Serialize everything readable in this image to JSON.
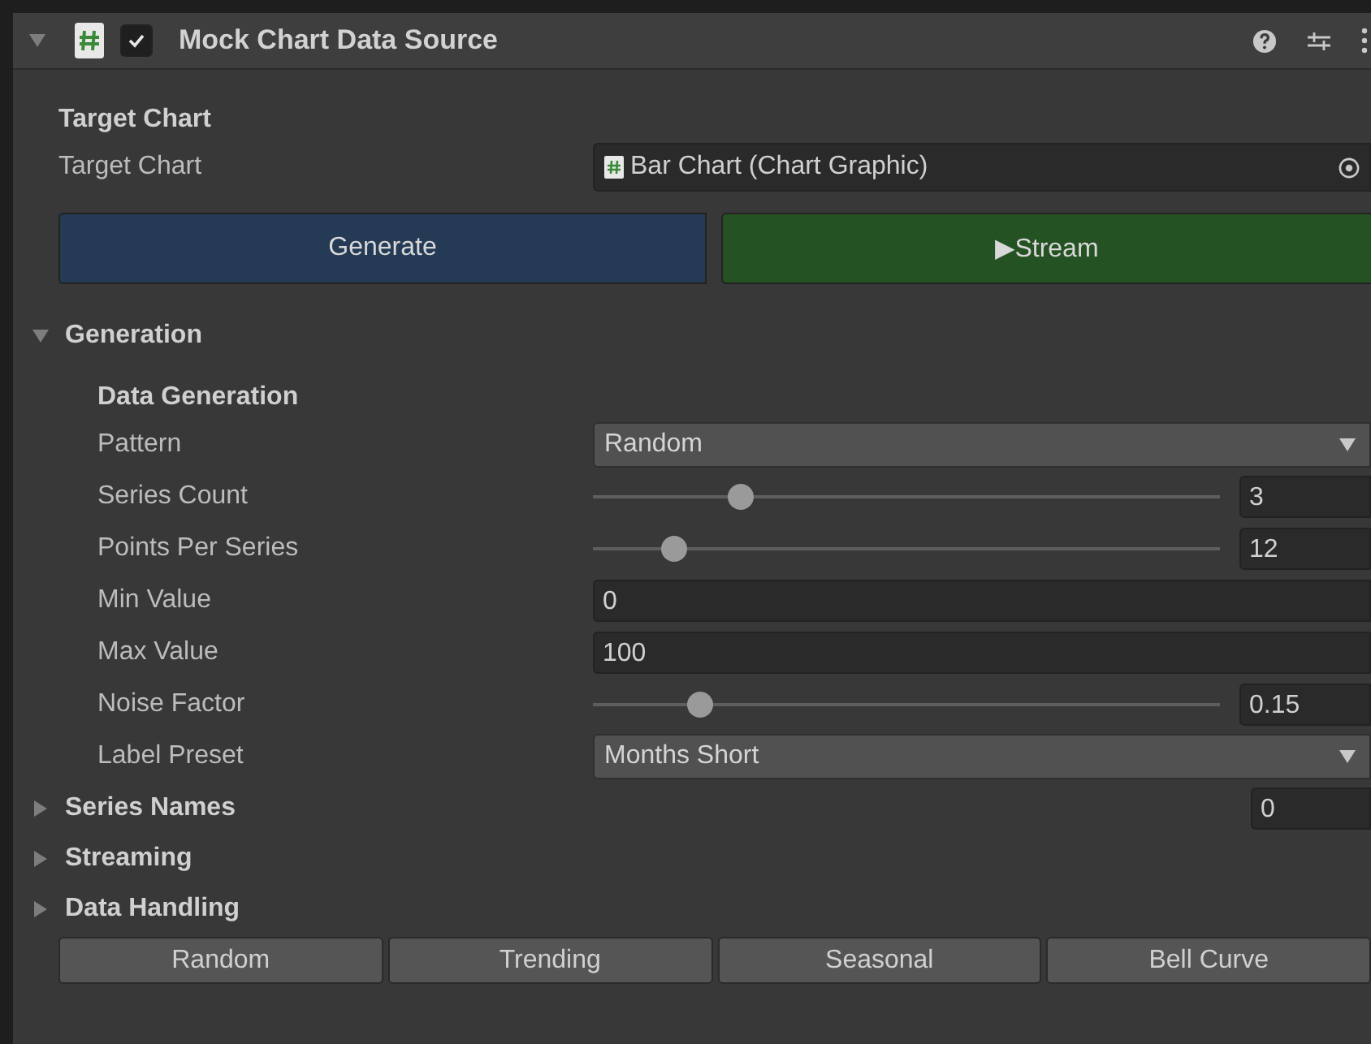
{
  "component": {
    "title": "Mock Chart Data Source",
    "enabled": true,
    "expanded": true
  },
  "target": {
    "heading": "Target Chart",
    "label": "Target Chart",
    "value": "Bar Chart (Chart Graphic)"
  },
  "actions": [
    {
      "label": "Generate",
      "kind": "generate"
    },
    {
      "label": "Stream",
      "icon": "▶",
      "kind": "stream"
    }
  ],
  "generation": {
    "title": "Generation",
    "expanded": true,
    "heading": "Data Generation",
    "fields": [
      {
        "kind": "dropdown",
        "label": "Pattern",
        "value": "Random"
      },
      {
        "kind": "slider",
        "label": "Series Count",
        "level": 0.235,
        "value": "3"
      },
      {
        "kind": "slider",
        "label": "Points Per Series",
        "level": 0.13,
        "value": "12"
      },
      {
        "kind": "number",
        "label": "Min Value",
        "value": "0"
      },
      {
        "kind": "number",
        "label": "Max Value",
        "value": "100"
      },
      {
        "kind": "slider",
        "label": "Noise Factor",
        "level": 0.17,
        "value": "0.15"
      },
      {
        "kind": "dropdown",
        "label": "Label Preset",
        "value": "Months Short"
      }
    ]
  },
  "foldouts": [
    {
      "title": "Series Names",
      "expanded": false,
      "count": "0"
    },
    {
      "title": "Streaming",
      "expanded": false
    },
    {
      "title": "Data Handling",
      "expanded": false
    }
  ],
  "presets": [
    "Random",
    "Trending",
    "Seasonal",
    "Bell Curve"
  ]
}
